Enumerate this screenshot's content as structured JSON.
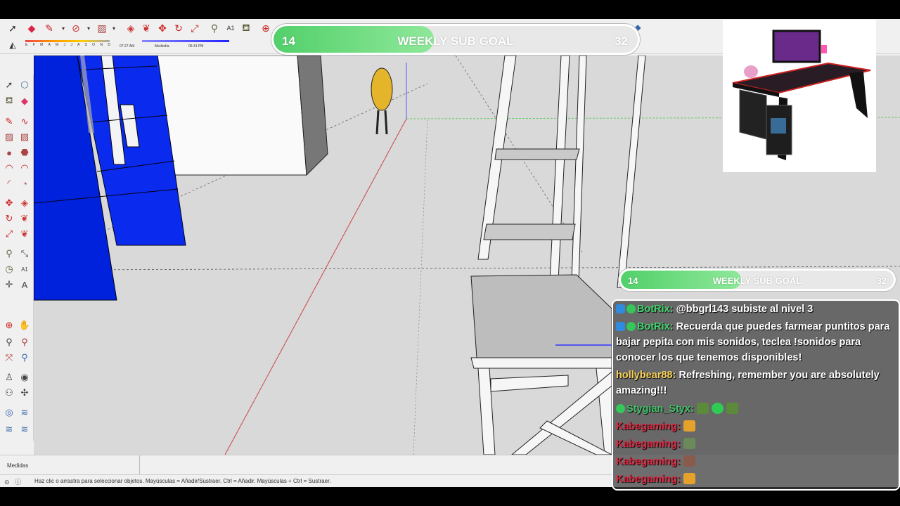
{
  "shadow_settings": {
    "months": "E F M A M J J A S O N D",
    "sunrise": "07:27 AM",
    "midday": "Mediodía",
    "sunset": "05:41 PM"
  },
  "goal_top": {
    "current": "14",
    "title": "WEEKLY SUB GOAL",
    "max": "32",
    "progress": 0.44
  },
  "goal_chat": {
    "current": "14",
    "title": "WEEKLY SUB GOAL",
    "max": "32",
    "progress": 0.44
  },
  "measure": {
    "label": "Medidas"
  },
  "status": {
    "text": "Haz clic o arrastra para seleccionar objetos. Mayúsculas = Añadir/Sustraer. Ctrl = Añadir. Mayúsculas + Ctrl = Sustraer."
  },
  "chat": {
    "messages": [
      {
        "user": "BotRix",
        "sep": ":",
        "text": " @bbgrl143 subiste al nivel 3"
      },
      {
        "user": "BotRix",
        "sep": ":",
        "text": " Recuerda que puedes farmear puntitos para bajar pepita con mis sonidos, teclea !sonidos para conocer los que tenemos disponibles!"
      },
      {
        "user": "hollybear88",
        "sep": ":",
        "text": " Refreshing, remember you are absolutely amazing!!!"
      },
      {
        "user": "Stygian_Styx",
        "sep": ":",
        "text": ""
      },
      {
        "user": "Kabegaming",
        "sep": ":",
        "text": ""
      },
      {
        "user": "Kabegaming",
        "sep": ":",
        "text": ""
      },
      {
        "user": "Kabegaming",
        "sep": ":",
        "text": ""
      },
      {
        "user": "Kabegaming",
        "sep": ":",
        "text": ""
      }
    ]
  },
  "colors": {
    "goal_fill": "#52d06a",
    "bot_name": "#41d36b",
    "holly_name": "#f7d25a",
    "kabe_name": "#d8263f",
    "model_blue": "#0022dd",
    "viewport_bg": "#d9d9d9"
  },
  "icons": {
    "select": "arrow-select-icon",
    "eraser": "eraser-icon",
    "pencil": "pencil-icon",
    "orbit": "orbit-icon",
    "zoom": "zoom-icon"
  }
}
